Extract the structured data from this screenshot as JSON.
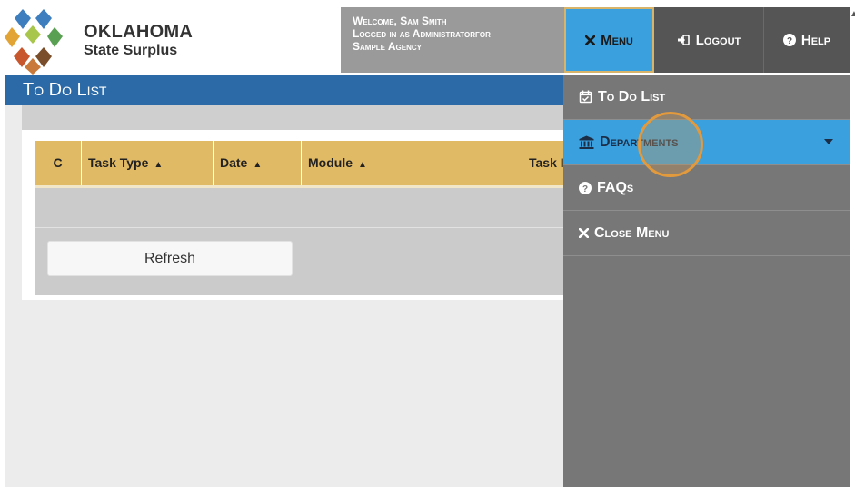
{
  "brand": {
    "line1": "OKLAHOMA",
    "line2": "State Surplus"
  },
  "welcome": {
    "line1": "Welcome, Sam Smith",
    "line2": "Logged in as Administratorfor",
    "line3": "Sample Agency"
  },
  "nav": {
    "menu": "Menu",
    "logout": "Logout",
    "help": "Help"
  },
  "page_title": "To Do List",
  "table": {
    "columns": [
      {
        "label": "C",
        "sortable": false
      },
      {
        "label": "Task Type",
        "sortable": true
      },
      {
        "label": "Date",
        "sortable": true
      },
      {
        "label": "Module",
        "sortable": true
      },
      {
        "label": "Task I",
        "sortable": false
      }
    ],
    "rows": []
  },
  "refresh_label": "Refresh",
  "dropdown": {
    "items": [
      {
        "label": "To Do List",
        "icon": "calendar-check-icon"
      },
      {
        "label": "Departments",
        "icon": "bank-icon",
        "active": true,
        "has_caret": true
      },
      {
        "label": "FAQs",
        "icon": "question-circle-icon"
      },
      {
        "label": "Close Menu",
        "icon": "close-icon"
      }
    ]
  },
  "colors": {
    "title_bar": "#2b6aa6",
    "menu_active": "#3aa1de",
    "table_header": "#e1ba65",
    "menu_bg": "#777777",
    "nav_bg": "#555555"
  }
}
